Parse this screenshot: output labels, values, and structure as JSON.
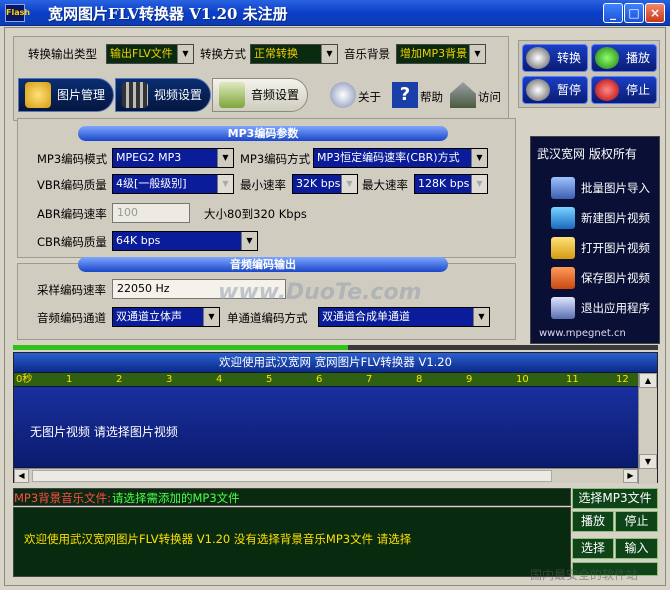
{
  "window": {
    "title": "宽网图片FLV转换器 V1.20 未注册",
    "icon_label": "Flash",
    "controls": {
      "minimize": "_",
      "maximize": "□",
      "close": "×"
    }
  },
  "toolbar": {
    "output_type": {
      "label": "转换输出类型",
      "value": "输出FLV文件"
    },
    "convert_mode": {
      "label": "转换方式",
      "value": "正常转换"
    },
    "music": {
      "label": "音乐背景",
      "value": "增加MP3背景"
    }
  },
  "action_buttons": {
    "convert": "转换",
    "play": "播放",
    "pause": "暂停",
    "stop": "停止"
  },
  "tabs": [
    {
      "label": "图片管理",
      "icon": "image-folder-icon"
    },
    {
      "label": "视频设置",
      "icon": "film-reel-icon"
    },
    {
      "label": "音频设置",
      "icon": "audio-wave-icon"
    }
  ],
  "links": {
    "about": "关于",
    "help": "帮助",
    "visit": "访问"
  },
  "mp3_section": {
    "title": "MP3编码参数",
    "mode_label": "MP3编码模式",
    "mode_value": "MPEG2 MP3",
    "method_label": "MP3编码方式",
    "method_value": "MP3恒定编码速率(CBR)方式",
    "vbr_label": "VBR编码质量",
    "vbr_value": "4级[一般级别]",
    "min_rate_label": "最小速率",
    "min_rate_value": "32K bps",
    "max_rate_label": "最大速率",
    "max_rate_value": "128K bps",
    "abr_label": "ABR编码速率",
    "abr_value": "100",
    "abr_hint": "大小80到320 Kbps",
    "cbr_label": "CBR编码质量",
    "cbr_value": "64K bps"
  },
  "audio_section": {
    "title": "音频编码输出",
    "sample_label": "采样编码速率",
    "sample_value": "22050 Hz",
    "channel_label": "音频编码通道",
    "channel_value": "双通道立体声",
    "mono_label": "单通道编码方式",
    "mono_value": "双通道合成单通道"
  },
  "watermark": "www.DuoTe.com",
  "side_panel": {
    "header": "武汉宽网 版权所有",
    "items": [
      {
        "label": "批量图片导入",
        "icon": "batch-import-icon"
      },
      {
        "label": "新建图片视频",
        "icon": "new-video-icon"
      },
      {
        "label": "打开图片视频",
        "icon": "open-folder-icon"
      },
      {
        "label": "保存图片视频",
        "icon": "save-disk-icon"
      },
      {
        "label": "退出应用程序",
        "icon": "exit-icon"
      }
    ],
    "footer": "www.mpegnet.cn"
  },
  "progress": 0.52,
  "timeline": {
    "title": "欢迎使用武汉宽网 宽网图片FLV转换器 V1.20",
    "ticks": [
      "0秒",
      "1",
      "2",
      "3",
      "4",
      "5",
      "6",
      "7",
      "8",
      "9",
      "10",
      "11",
      "12"
    ],
    "empty_message": "无图片视频 请选择图片视频"
  },
  "music_file": {
    "label": "MP3背景音乐文件:",
    "value": "请选择需添加的MP3文件"
  },
  "status_message": "欢迎使用武汉宽网图片FLV转换器 V1.20 没有选择背景音乐MP3文件 请选择",
  "music_buttons": {
    "select_mp3": "选择MP3文件",
    "play": "播放",
    "stop": "停止",
    "select": "选择",
    "import": "输入"
  },
  "corner_watermark": "国内最安全的软件站"
}
